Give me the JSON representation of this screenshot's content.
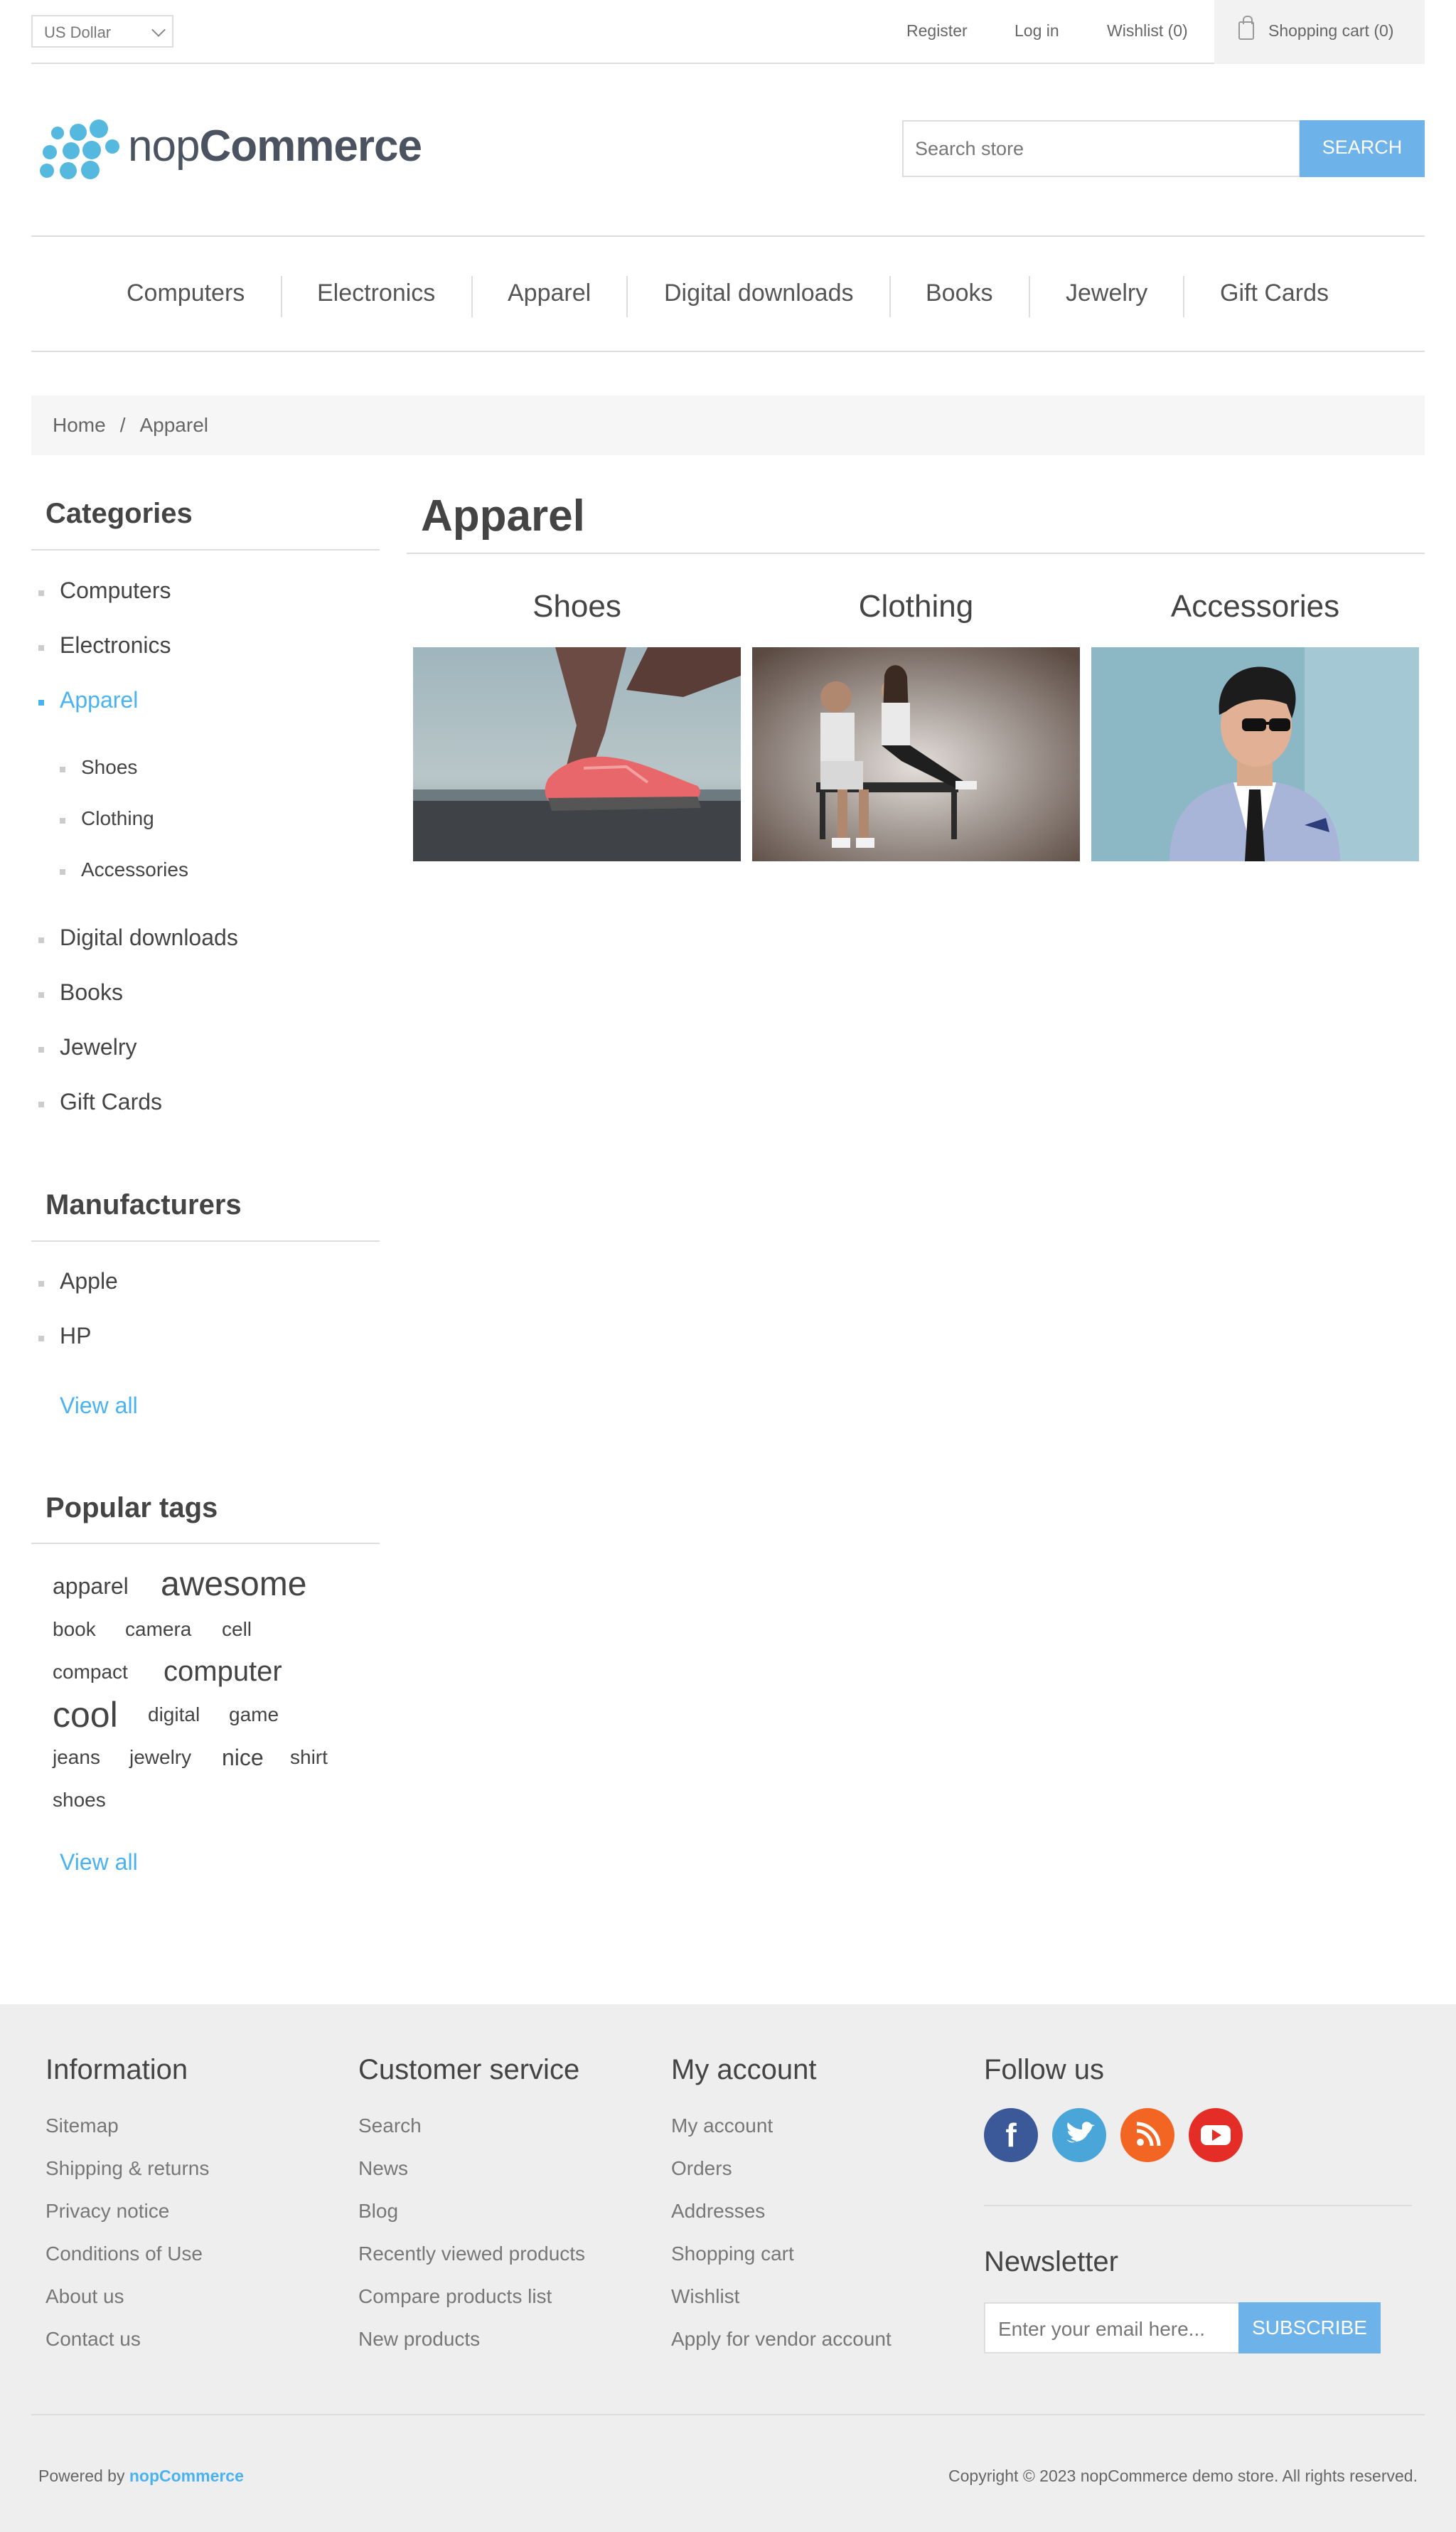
{
  "header": {
    "currency": "US Dollar",
    "register": "Register",
    "login": "Log in",
    "wishlist": "Wishlist (0)",
    "cart": "Shopping cart (0)"
  },
  "logo": {
    "prefix": "nop",
    "suffix": "Commerce",
    "color": "#55b8df"
  },
  "search": {
    "placeholder": "Search store",
    "button": "SEARCH"
  },
  "nav": [
    "Computers",
    "Electronics",
    "Apparel",
    "Digital downloads",
    "Books",
    "Jewelry",
    "Gift Cards"
  ],
  "breadcrumb": {
    "home": "Home",
    "separator": "/",
    "current": "Apparel"
  },
  "sidebar": {
    "categories_title": "Categories",
    "categories": [
      "Computers",
      "Electronics",
      "Apparel",
      "Digital downloads",
      "Books",
      "Jewelry",
      "Gift Cards"
    ],
    "subcategories": [
      "Shoes",
      "Clothing",
      "Accessories"
    ],
    "manufacturers_title": "Manufacturers",
    "manufacturers": [
      "Apple",
      "HP"
    ],
    "view_all": "View all",
    "tags_title": "Popular tags",
    "tags": [
      "apparel",
      "awesome",
      "book",
      "camera",
      "cell",
      "compact",
      "computer",
      "cool",
      "digital",
      "game",
      "jeans",
      "jewelry",
      "nice",
      "shirt",
      "shoes"
    ]
  },
  "main": {
    "title": "Apparel",
    "subcategories": [
      "Shoes",
      "Clothing",
      "Accessories"
    ]
  },
  "footer": {
    "information_title": "Information",
    "information": [
      "Sitemap",
      "Shipping & returns",
      "Privacy notice",
      "Conditions of Use",
      "About us",
      "Contact us"
    ],
    "service_title": "Customer service",
    "service": [
      "Search",
      "News",
      "Blog",
      "Recently viewed products",
      "Compare products list",
      "New products"
    ],
    "account_title": "My account",
    "account": [
      "My account",
      "Orders",
      "Addresses",
      "Shopping cart",
      "Wishlist",
      "Apply for vendor account"
    ],
    "follow_title": "Follow us",
    "social_icons": [
      "facebook-icon",
      "twitter-icon",
      "rss-icon",
      "youtube-icon"
    ],
    "newsletter_title": "Newsletter",
    "newsletter_placeholder": "Enter your email here...",
    "subscribe": "SUBSCRIBE",
    "powered_by": "Powered by",
    "powered_brand": "nopCommerce",
    "copyright": "Copyright © 2023 nopCommerce demo store. All rights reserved."
  },
  "colors": {
    "accent": "#4ab2f1",
    "button": "#6db3ea",
    "footer_bg": "#eeeeee"
  }
}
